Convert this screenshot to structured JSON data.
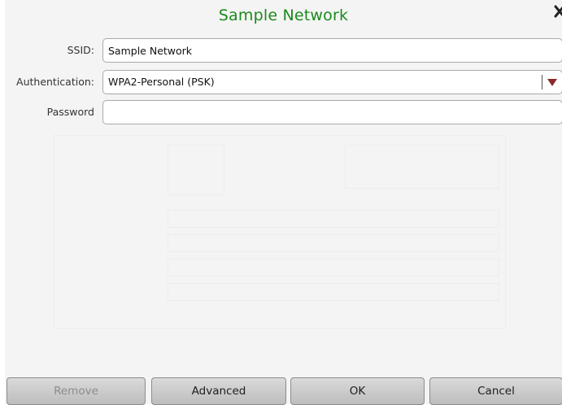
{
  "dialog": {
    "title": "Sample Network",
    "close_icon": "close-icon"
  },
  "form": {
    "ssid_label": "SSID:",
    "ssid_value": "Sample Network",
    "auth_label": "Authentication:",
    "auth_value": "WPA2-Personal (PSK)",
    "password_label": "Password",
    "password_value": ""
  },
  "buttons": {
    "remove": "Remove",
    "advanced": "Advanced",
    "ok": "OK",
    "cancel": "Cancel"
  },
  "colors": {
    "title": "#1a8a1a",
    "dropdown_arrow": "#8a2a2a"
  }
}
